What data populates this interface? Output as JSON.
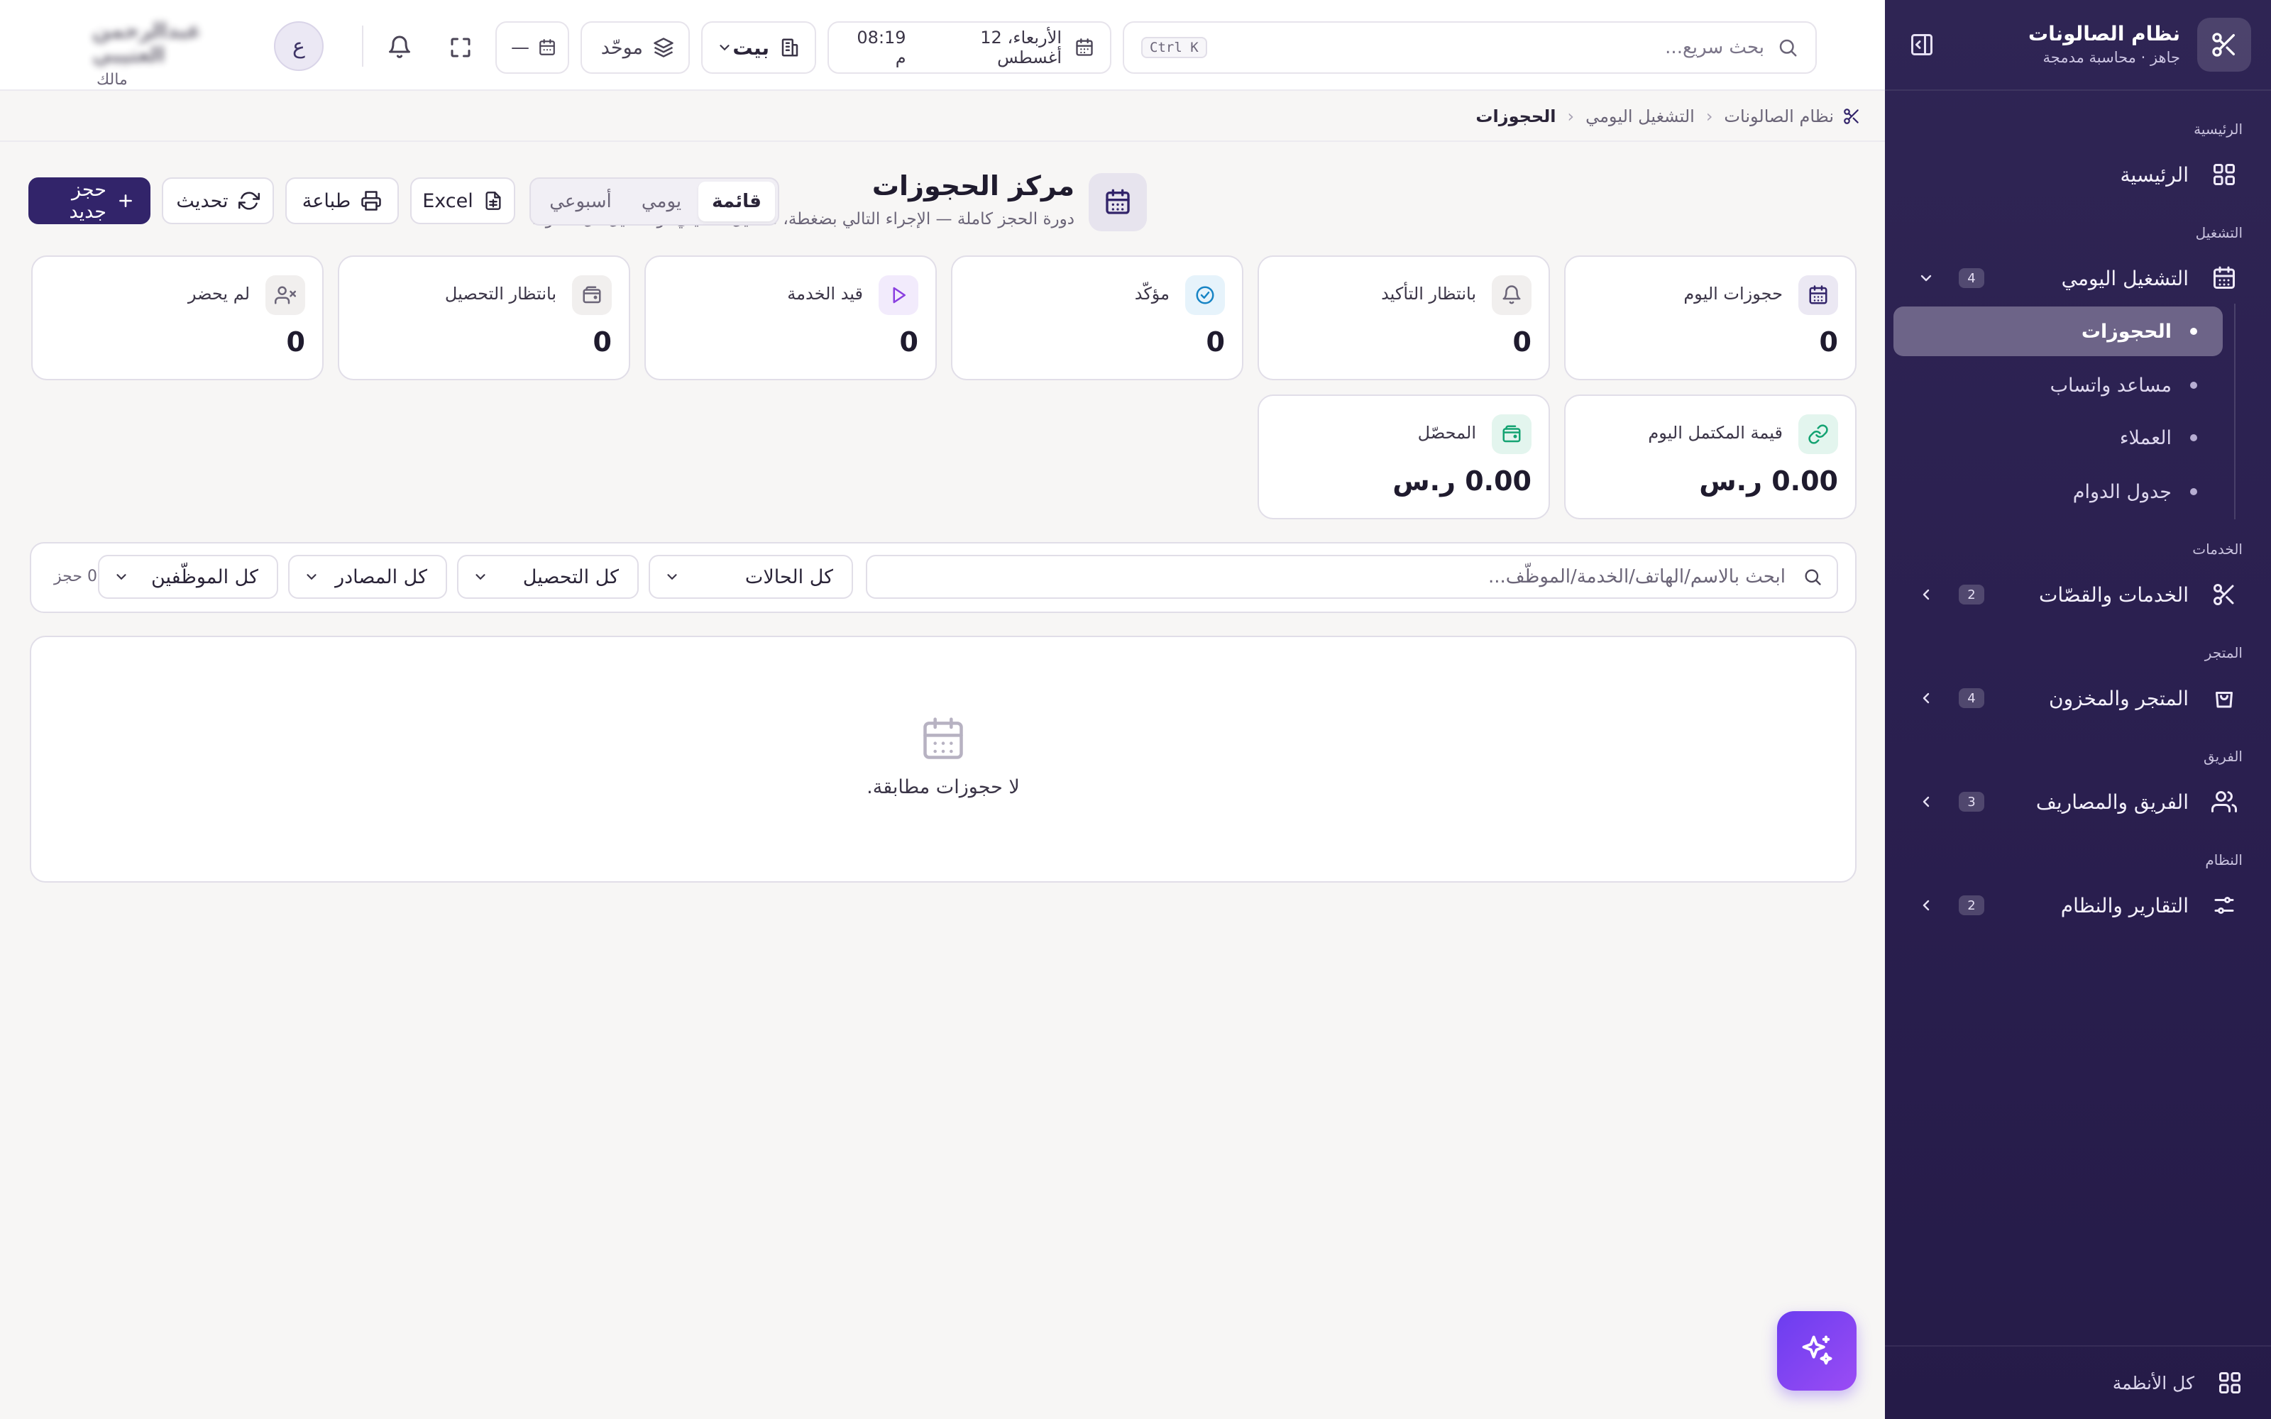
{
  "sidebar": {
    "brand_title": "نظام الصالونات",
    "brand_subtitle": "جاهز · محاسبة مدمجة",
    "sections": {
      "home": "الرئيسية",
      "operations": "التشغيل",
      "services": "الخدمات",
      "store": "المتجر",
      "team": "الفريق",
      "system": "النظام"
    },
    "items": {
      "home": {
        "label": "الرئيسية",
        "icon": "grid-icon"
      },
      "daily_ops": {
        "label": "التشغيل اليومي",
        "count": "4",
        "icon": "calendar-icon"
      },
      "services": {
        "label": "الخدمات والقصّات",
        "count": "2",
        "icon": "scissors-icon"
      },
      "store": {
        "label": "المتجر والمخزون",
        "count": "4",
        "icon": "shopping-bag-icon"
      },
      "team": {
        "label": "الفريق والمصاريف",
        "count": "3",
        "icon": "users-icon"
      },
      "reports": {
        "label": "التقارير والنظام",
        "count": "2",
        "icon": "sliders-icon"
      }
    },
    "subitems": {
      "bookings": "الحجوزات",
      "whatsapp": "مساعد واتساب",
      "clients": "العملاء",
      "schedule": "جدول الدوام"
    },
    "footer_label": "كل الأنظمة",
    "accent": "#2a1f4f"
  },
  "topbar": {
    "search_placeholder": "بحث سريع...",
    "shortcut": "Ctrl K",
    "date": "الأربعاء، 12 أغسطس",
    "time": "08:19 م",
    "branch": "بيت",
    "unified": "موحّد",
    "datepicker_value": "—",
    "avatar_initial": "ع",
    "user_name": "عبدالرحمن العتيبي",
    "user_role": "مالك"
  },
  "breadcrumb": {
    "root": "نظام الصالونات",
    "section": "التشغيل اليومي",
    "current": "الحجوزات"
  },
  "page": {
    "title": "مركز الحجوزات",
    "subtitle": "دورة الحجز كاملة — الإجراء التالي بضغطة، تحصيل تشغيلي، وتفاصيل كل خطوة.",
    "view_tabs": {
      "list": "قائمة",
      "daily": "يومي",
      "weekly": "أسبوعي"
    },
    "actions": {
      "excel": "Excel",
      "print": "طباعة",
      "refresh": "تحديث",
      "new_booking": "حجز جديد"
    }
  },
  "stats": {
    "today_bookings": {
      "label": "حجوزات اليوم",
      "value": "0"
    },
    "pending_confirm": {
      "label": "بانتظار التأكيد",
      "value": "0"
    },
    "confirmed": {
      "label": "مؤكّد",
      "value": "0"
    },
    "in_service": {
      "label": "قيد الخدمة",
      "value": "0"
    },
    "pending_payment": {
      "label": "بانتظار التحصيل",
      "value": "0"
    },
    "no_show": {
      "label": "لم يحضر",
      "value": "0"
    },
    "completed_value": {
      "label": "قيمة المكتمل اليوم",
      "value": "0.00 ر.س"
    },
    "collected": {
      "label": "المحصّل",
      "value": "0.00 ر.س"
    }
  },
  "filters": {
    "search_placeholder": "ابحث بالاسم/الهاتف/الخدمة/الموظّف...",
    "status": "كل الحالات",
    "payment": "كل التحصيل",
    "source": "كل المصادر",
    "staff": "كل الموظّفين",
    "count": "0 حجز"
  },
  "empty_state": {
    "message": "لا حجوزات مطابقة."
  },
  "fab": {
    "icon": "sparkles-icon"
  }
}
